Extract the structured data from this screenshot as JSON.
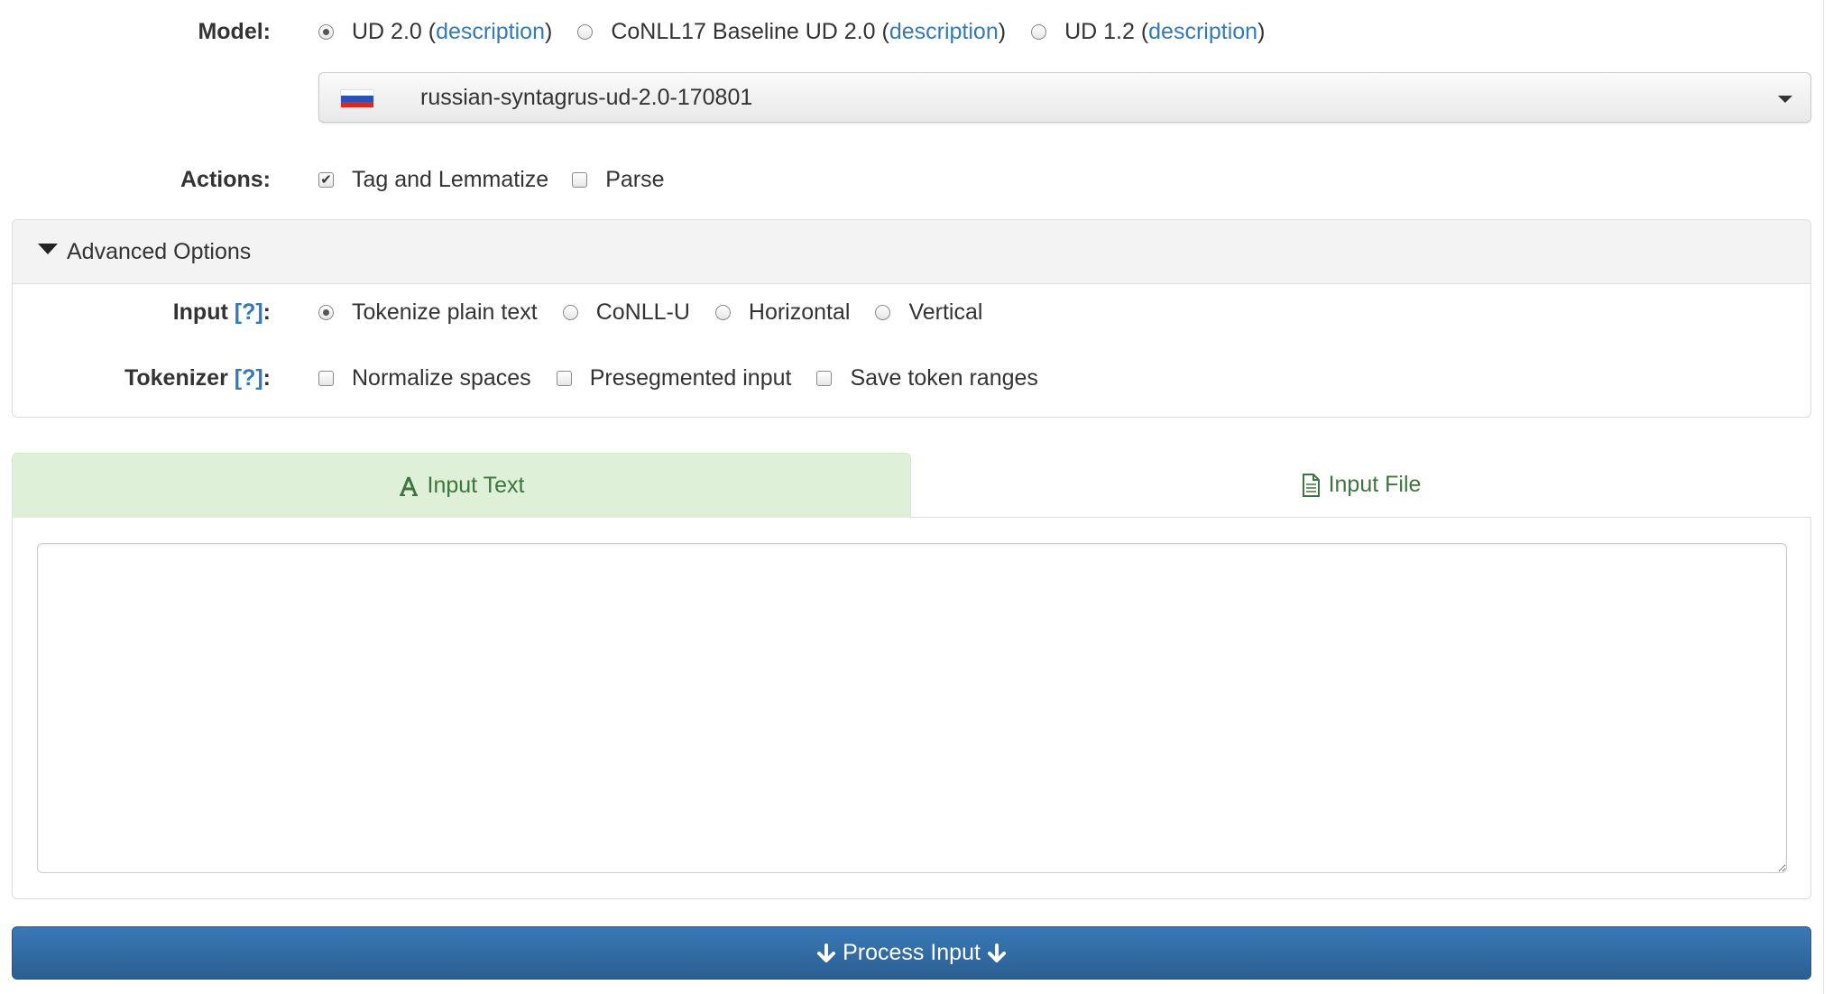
{
  "model": {
    "label": "Model:",
    "options": [
      {
        "prefix": "UD 2.0 (",
        "link": "description",
        "suffix": ")",
        "selected": true
      },
      {
        "prefix": "CoNLL17 Baseline UD 2.0 (",
        "link": "description",
        "suffix": ")",
        "selected": false
      },
      {
        "prefix": "UD 1.2 (",
        "link": "description",
        "suffix": ")",
        "selected": false
      }
    ],
    "selected_model": "russian-syntagrus-ud-2.0-170801",
    "flag_colors": [
      "#ffffff",
      "#2a52be",
      "#d52b1e"
    ]
  },
  "actions": {
    "label": "Actions:",
    "options": [
      {
        "label": "Tag and Lemmatize",
        "checked": true
      },
      {
        "label": "Parse",
        "checked": false
      }
    ]
  },
  "advanced": {
    "title": "Advanced Options",
    "input": {
      "label": "Input",
      "help": "[?]",
      "colon": ":",
      "options": [
        {
          "label": "Tokenize plain text",
          "selected": true
        },
        {
          "label": "CoNLL-U",
          "selected": false
        },
        {
          "label": "Horizontal",
          "selected": false
        },
        {
          "label": "Vertical",
          "selected": false
        }
      ]
    },
    "tokenizer": {
      "label": "Tokenizer",
      "help": "[?]",
      "colon": ":",
      "options": [
        {
          "label": "Normalize spaces",
          "checked": false
        },
        {
          "label": "Presegmented input",
          "checked": false
        },
        {
          "label": "Save token ranges",
          "checked": false
        }
      ]
    }
  },
  "tabs": {
    "input_text": "Input Text",
    "input_file": "Input File",
    "active": "input_text"
  },
  "textarea_value": "",
  "process_button": "Process Input",
  "colors": {
    "link": "#337ab7",
    "tab_active_bg": "#dff0d8",
    "tab_text": "#3c763d",
    "button_bg": "#2f6ba3"
  }
}
